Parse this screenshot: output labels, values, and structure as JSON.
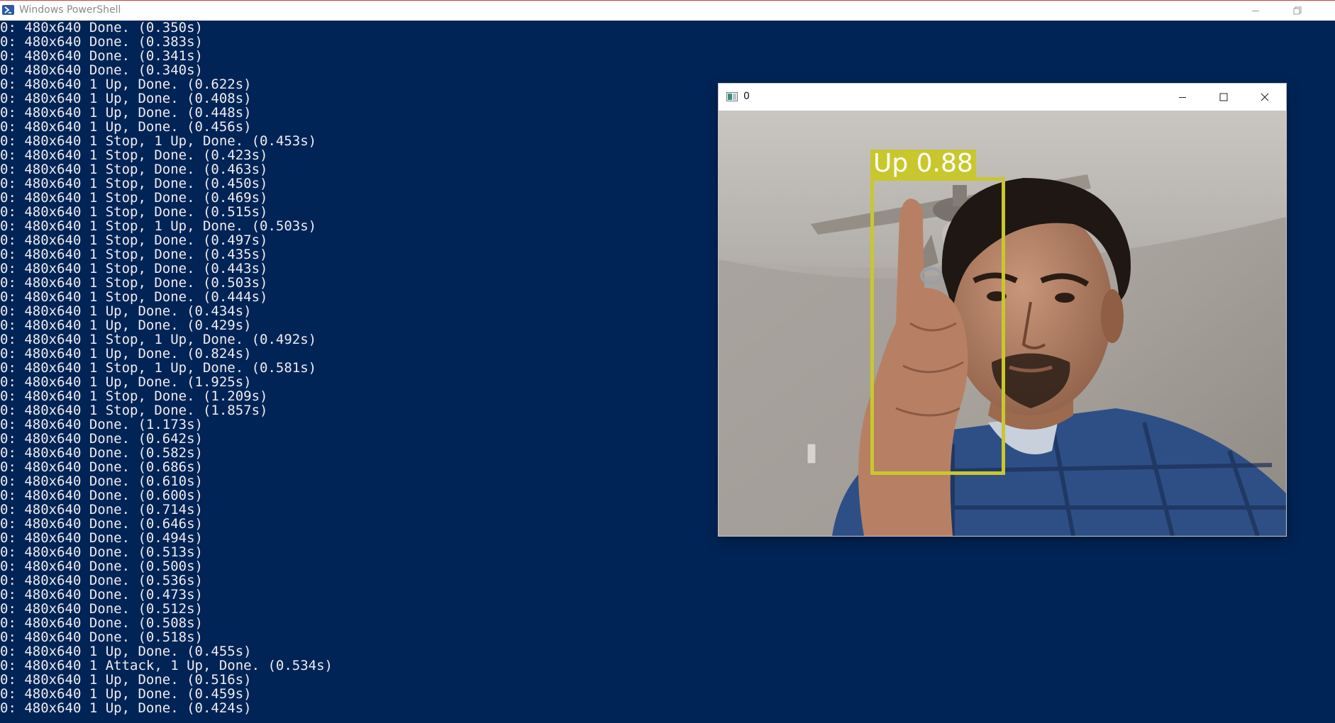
{
  "powershell": {
    "title": "Windows PowerShell",
    "colors": {
      "background": "#012456",
      "text": "#eeedf0"
    },
    "icons": [
      "powershell-icon",
      "minimize-icon",
      "restore-icon"
    ]
  },
  "console": {
    "lines": [
      "0: 480x640 Done. (0.350s)",
      "0: 480x640 Done. (0.383s)",
      "0: 480x640 Done. (0.341s)",
      "0: 480x640 Done. (0.340s)",
      "0: 480x640 1 Up, Done. (0.622s)",
      "0: 480x640 1 Up, Done. (0.408s)",
      "0: 480x640 1 Up, Done. (0.448s)",
      "0: 480x640 1 Up, Done. (0.456s)",
      "0: 480x640 1 Stop, 1 Up, Done. (0.453s)",
      "0: 480x640 1 Stop, Done. (0.423s)",
      "0: 480x640 1 Stop, Done. (0.463s)",
      "0: 480x640 1 Stop, Done. (0.450s)",
      "0: 480x640 1 Stop, Done. (0.469s)",
      "0: 480x640 1 Stop, Done. (0.515s)",
      "0: 480x640 1 Stop, 1 Up, Done. (0.503s)",
      "0: 480x640 1 Stop, Done. (0.497s)",
      "0: 480x640 1 Stop, Done. (0.435s)",
      "0: 480x640 1 Stop, Done. (0.443s)",
      "0: 480x640 1 Stop, Done. (0.503s)",
      "0: 480x640 1 Stop, Done. (0.444s)",
      "0: 480x640 1 Up, Done. (0.434s)",
      "0: 480x640 1 Up, Done. (0.429s)",
      "0: 480x640 1 Stop, 1 Up, Done. (0.492s)",
      "0: 480x640 1 Up, Done. (0.824s)",
      "0: 480x640 1 Stop, 1 Up, Done. (0.581s)",
      "0: 480x640 1 Up, Done. (1.925s)",
      "0: 480x640 1 Stop, Done. (1.209s)",
      "0: 480x640 1 Stop, Done. (1.857s)",
      "0: 480x640 Done. (1.173s)",
      "0: 480x640 Done. (0.642s)",
      "0: 480x640 Done. (0.582s)",
      "0: 480x640 Done. (0.686s)",
      "0: 480x640 Done. (0.610s)",
      "0: 480x640 Done. (0.600s)",
      "0: 480x640 Done. (0.714s)",
      "0: 480x640 Done. (0.646s)",
      "0: 480x640 Done. (0.494s)",
      "0: 480x640 Done. (0.513s)",
      "0: 480x640 Done. (0.500s)",
      "0: 480x640 Done. (0.536s)",
      "0: 480x640 Done. (0.473s)",
      "0: 480x640 Done. (0.512s)",
      "0: 480x640 Done. (0.508s)",
      "0: 480x640 Done. (0.518s)",
      "0: 480x640 1 Up, Done. (0.455s)",
      "0: 480x640 1 Attack, 1 Up, Done. (0.534s)",
      "0: 480x640 1 Up, Done. (0.516s)",
      "0: 480x640 1 Up, Done. (0.459s)",
      "0: 480x640 1 Up, Done. (0.424s)"
    ]
  },
  "image_window": {
    "title": "0",
    "icons": [
      "window-app-icon",
      "minimize-icon",
      "maximize-icon",
      "close-icon"
    ],
    "detection": {
      "label": "Up 0.88",
      "color": "#c9c72e"
    }
  }
}
